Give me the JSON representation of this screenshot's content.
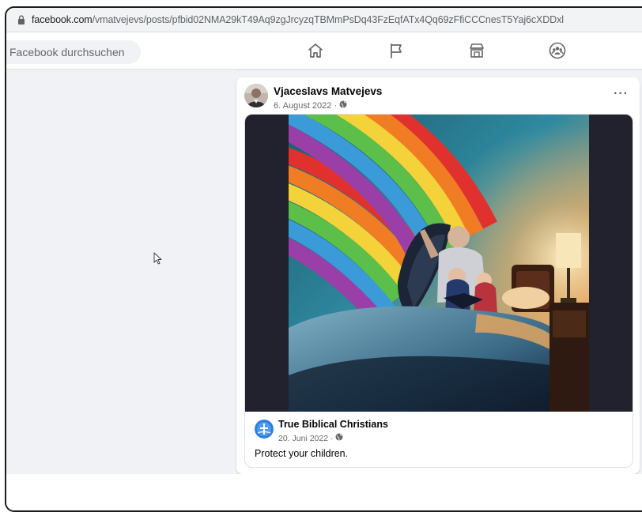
{
  "browser": {
    "url_host": "facebook.com",
    "url_path": "/vmatvejevs/posts/pfbid02NMA29kT49Aq9zgJrcyzqTBMmPsDq43FzEqfATx4Qq69zFfiCCCnesT5Yaj6cXDDxl"
  },
  "fb": {
    "search_placeholder": "Facebook durchsuchen"
  },
  "post": {
    "author": "Vjaceslavs Matvejevs",
    "date": "6. August 2022 ·",
    "more_label": "···",
    "shared": {
      "author": "True Biblical Christians",
      "date": "20. Juni 2022 ·",
      "text": "Protect your children."
    }
  },
  "colors": {
    "fb_bg": "#f0f2f5",
    "card_bg": "#ffffff",
    "secondary_text": "#65676b"
  },
  "icons": [
    "lock-icon",
    "home-icon",
    "pages-flag-icon",
    "marketplace-icon",
    "groups-icon",
    "globe-icon",
    "more-icon",
    "cursor-icon"
  ]
}
